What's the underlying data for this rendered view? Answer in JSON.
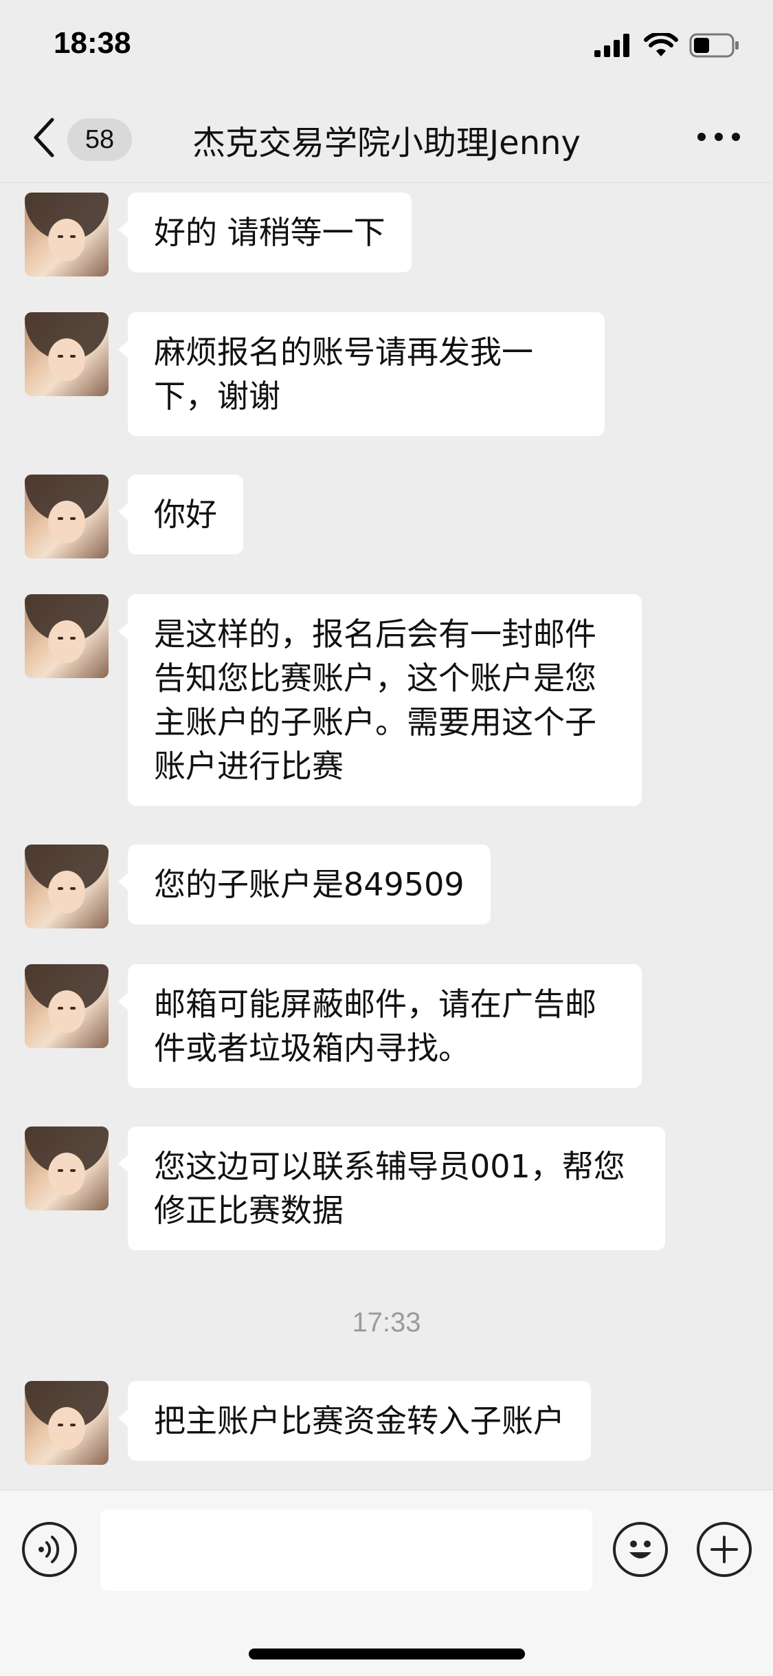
{
  "status_bar": {
    "time": "18:38"
  },
  "header": {
    "unread_count": "58",
    "title": "杰克交易学院小助理Jenny"
  },
  "messages": [
    {
      "text": "好的 请稍等一下"
    },
    {
      "text": "麻烦报名的账号请再发我一下，谢谢"
    },
    {
      "text": "你好"
    },
    {
      "text": "是这样的，报名后会有一封邮件告知您比赛账户，这个账户是您主账户的子账户。需要用这个子账户进行比赛"
    },
    {
      "text": "您的子账户是849509"
    },
    {
      "text": "邮箱可能屏蔽邮件，请在广告邮件或者垃圾箱内寻找。"
    },
    {
      "text": "您这边可以联系辅导员001，帮您修正比赛数据"
    },
    {
      "text": "把主账户比赛资金转入子账户"
    }
  ],
  "time_divider": "17:33",
  "input": {
    "value": "",
    "placeholder": ""
  },
  "icons": {
    "back": "back-chevron-icon",
    "more": "more-dots-icon",
    "voice": "voice-icon",
    "emoji": "emoji-icon",
    "plus": "plus-icon"
  }
}
